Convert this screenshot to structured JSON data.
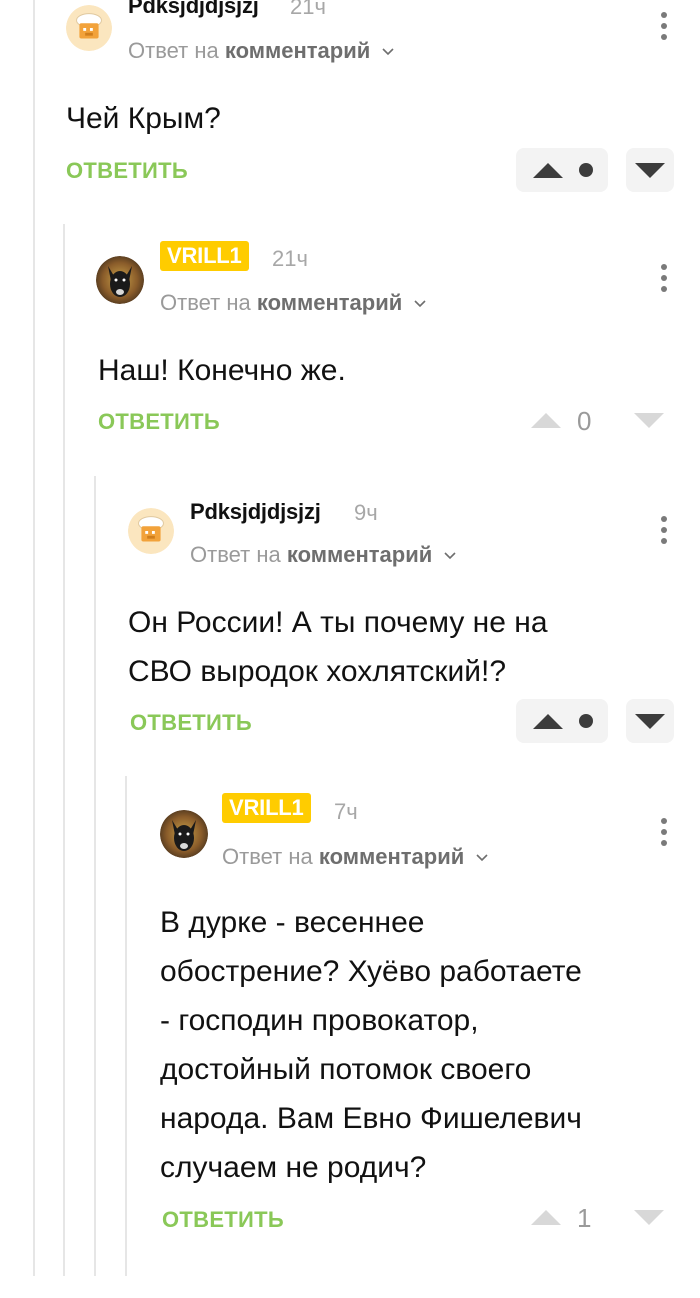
{
  "comments": [
    {
      "author": "Pdksjdjdjsjzj",
      "time": "21ч",
      "reply_prefix": "Ответ на",
      "reply_link": "комментарий",
      "text": [
        "Чей Крым?"
      ],
      "reply_label": "ОТВЕТИТЬ",
      "rating": "",
      "avatar": "chef-hat-avatar"
    },
    {
      "author": "VRILL1",
      "time": "21ч",
      "reply_prefix": "Ответ на",
      "reply_link": "комментарий",
      "text": [
        "Наш! Конечно же."
      ],
      "reply_label": "ОТВЕТИТЬ",
      "rating": "0",
      "avatar": "dog-avatar"
    },
    {
      "author": "Pdksjdjdjsjzj",
      "time": "9ч",
      "reply_prefix": "Ответ на",
      "reply_link": "комментарий",
      "text": [
        "Он России! А ты почему не на",
        "СВО выродок хохлятский!?"
      ],
      "reply_label": "ОТВЕТИТЬ",
      "rating": "",
      "avatar": "chef-hat-avatar"
    },
    {
      "author": "VRILL1",
      "time": "7ч",
      "reply_prefix": "Ответ на",
      "reply_link": "комментарий",
      "text": [
        "В дурке - весеннее",
        "обострение? Хуёво работаете",
        "- господин провокатор,",
        "достойный потомок своего",
        "народа. Вам Евно Фишелевич",
        "случаем не родич?"
      ],
      "reply_label": "ОТВЕТИТЬ",
      "rating": "1",
      "avatar": "dog-avatar"
    }
  ],
  "colors": {
    "accent_green": "#8ac858",
    "badge_yellow": "#ffcc00",
    "muted_gray": "#9a9a9a"
  },
  "icons": [
    "chef-hat-icon",
    "dog-icon",
    "chevron-down-icon",
    "kebab-menu-icon",
    "upvote-icon",
    "downvote-icon"
  ]
}
